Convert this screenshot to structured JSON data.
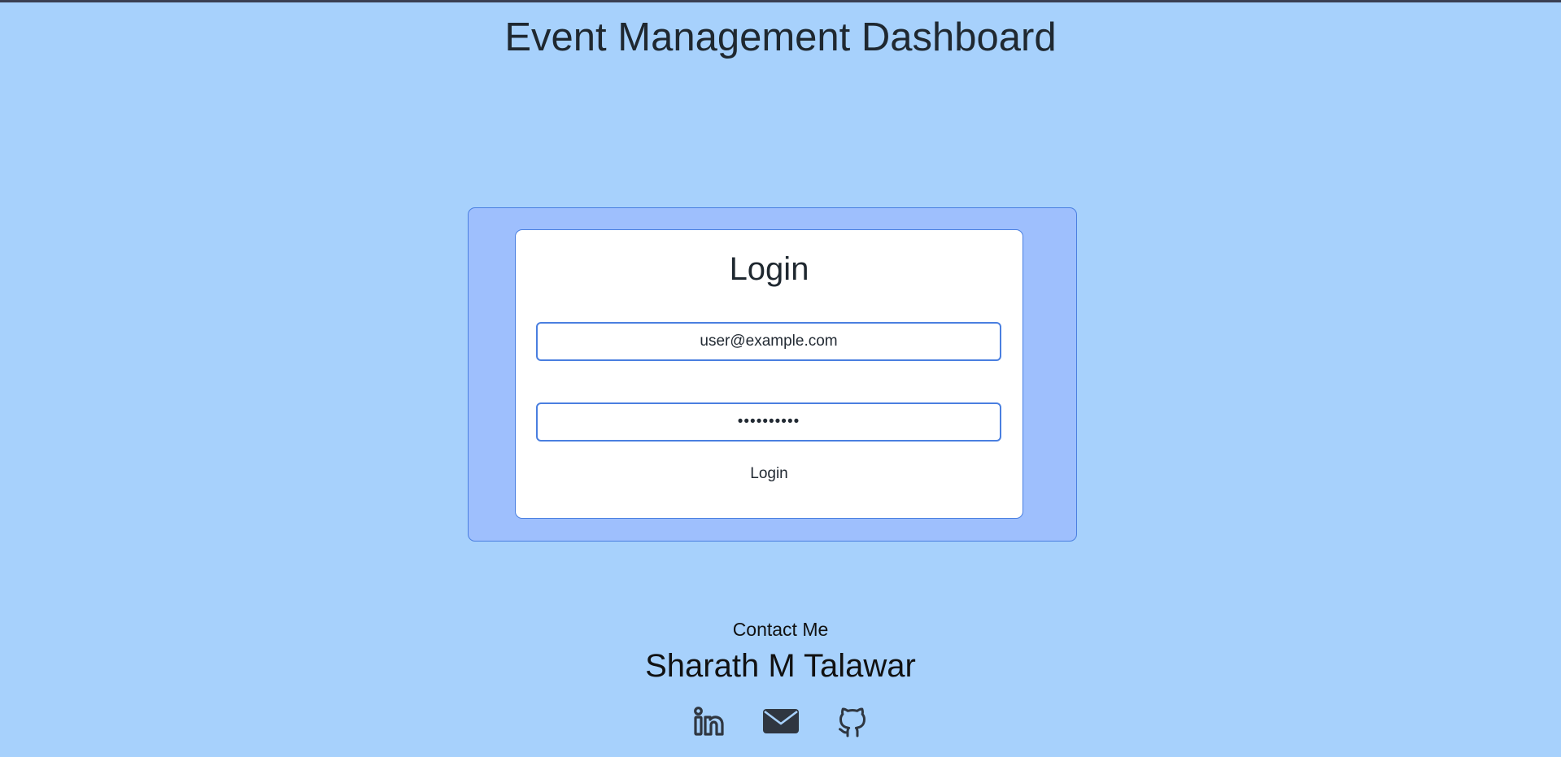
{
  "header": {
    "title": "Event Management Dashboard"
  },
  "login": {
    "title": "Login",
    "email_value": "user@example.com",
    "password_value": "••••••••••",
    "button_label": "Login"
  },
  "footer": {
    "contact_label": "Contact Me",
    "name": "Sharath M Talawar",
    "social_icons": [
      "linkedin-icon",
      "email-icon",
      "github-icon"
    ]
  },
  "colors": {
    "background": "#a7d1fc",
    "panel": "#9ebffd",
    "accent_border": "#4a7fe0",
    "icon": "#2f3640"
  }
}
